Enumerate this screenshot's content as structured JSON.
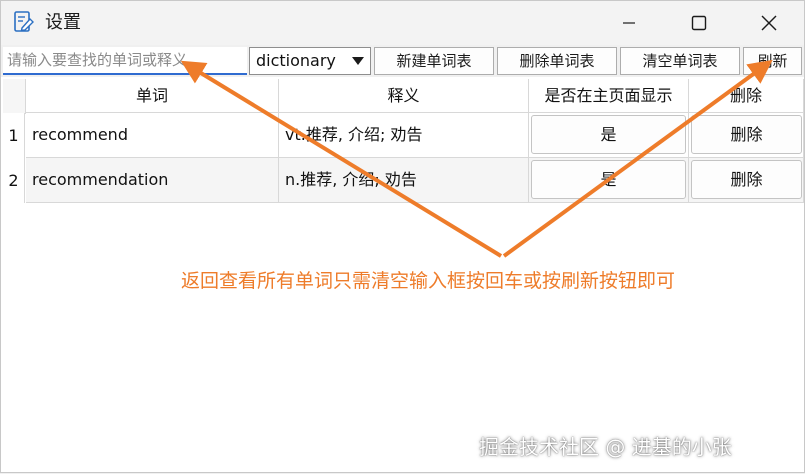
{
  "window": {
    "title": "设置",
    "controls": [
      "minimize-icon",
      "maximize-icon",
      "close-icon"
    ]
  },
  "toolbar": {
    "search_placeholder": "请输入要查找的单词或释义",
    "dictionary_select": "dictionary",
    "new_wordlist": "新建单词表",
    "delete_wordlist": "删除单词表",
    "clear_wordlist": "清空单词表",
    "refresh": "刷新"
  },
  "table": {
    "headers": [
      "单词",
      "释义",
      "是否在主页面显示",
      "删除"
    ],
    "rows": [
      {
        "num": "1",
        "word": "recommend",
        "meaning": "vt.推荐, 介绍; 劝告",
        "show": "是",
        "delete": "删除"
      },
      {
        "num": "2",
        "word": "recommendation",
        "meaning": "n.推荐, 介绍; 劝告",
        "show": "是",
        "delete": "删除"
      }
    ]
  },
  "annotation": {
    "text": "返回查看所有单词只需清空输入框按回车或按刷新按钮即可",
    "color": "#ee7c2a"
  },
  "watermark": "掘金技术社区 @ 进基的小张"
}
